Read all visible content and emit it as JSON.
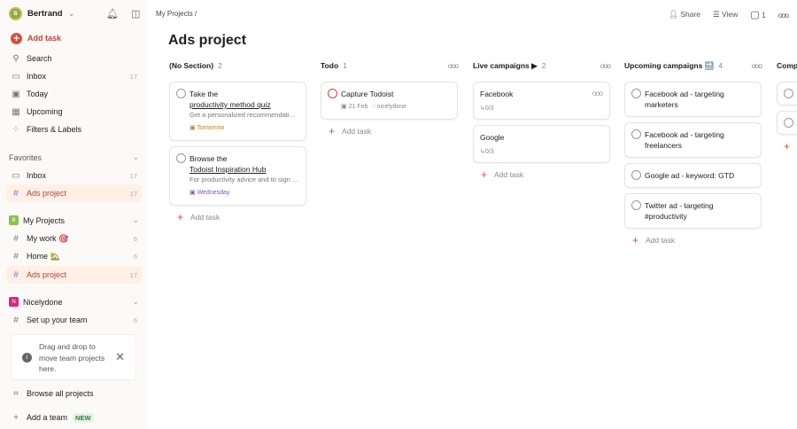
{
  "user": {
    "name": "Bertrand",
    "initial": "B"
  },
  "sidebar": {
    "add_task": "Add task",
    "nav": [
      {
        "label": "Search",
        "icon": "search-icon"
      },
      {
        "label": "Inbox",
        "count": "17",
        "icon": "inbox-icon"
      },
      {
        "label": "Today",
        "icon": "today-icon"
      },
      {
        "label": "Upcoming",
        "icon": "calendar-icon"
      },
      {
        "label": "Filters & Labels",
        "icon": "filters-icon"
      }
    ],
    "favorites": {
      "title": "Favorites",
      "items": [
        {
          "label": "Inbox",
          "count": "17"
        },
        {
          "label": "Ads project",
          "count": "17"
        }
      ]
    },
    "my_projects": {
      "title": "My Projects",
      "badge": "B",
      "items": [
        {
          "label": "My work 🎯",
          "count": "6"
        },
        {
          "label": "Home 🏡",
          "count": "6"
        },
        {
          "label": "Ads project",
          "count": "17"
        }
      ]
    },
    "team": {
      "title": "Nicelydone",
      "badge": "N",
      "items": [
        {
          "label": "Set up your team",
          "count": "6"
        }
      ]
    },
    "tip": "Drag and drop to move team projects here.",
    "browse": "Browse all projects",
    "add_team": "Add a team",
    "new_badge": "NEW"
  },
  "header": {
    "breadcrumb": "My Projects /",
    "share": "Share",
    "view": "View",
    "comments": "1",
    "title": "Ads project"
  },
  "columns": [
    {
      "title": "(No Section)",
      "count": "2",
      "tasks": [
        {
          "line1": "Take the",
          "link": "productivity method quiz",
          "desc": "Get a personalized recommendation...",
          "due": "Tomorrow",
          "due_color": "#d97a1c"
        },
        {
          "line1": "Browse the",
          "link": "Todoist Inspiration Hub",
          "desc": "For productivity advice and to sign ...",
          "due": "Wednesday",
          "due_color": "#8a4fd8"
        }
      ]
    },
    {
      "title": "Todo",
      "count": "1",
      "tasks": [
        {
          "line1": "Capture Todoist",
          "date": "21 Feb",
          "label": "nicelydone"
        }
      ]
    },
    {
      "title": "Live campaigns ▶",
      "count": "2",
      "tasks": [
        {
          "line1": "Facebook",
          "sub": "0/3"
        },
        {
          "line1": "Google",
          "sub": "0/3"
        }
      ]
    },
    {
      "title": "Upcoming campaigns 🔜",
      "count": "4",
      "tasks": [
        {
          "line1": "Facebook ad - targeting marketers"
        },
        {
          "line1": "Facebook ad - targeting freelancers"
        },
        {
          "line1": "Google ad - keyword: GTD"
        },
        {
          "line1": "Twitter ad - targeting #productivity"
        }
      ]
    },
    {
      "title": "Comp"
    }
  ],
  "add_task": "Add task"
}
